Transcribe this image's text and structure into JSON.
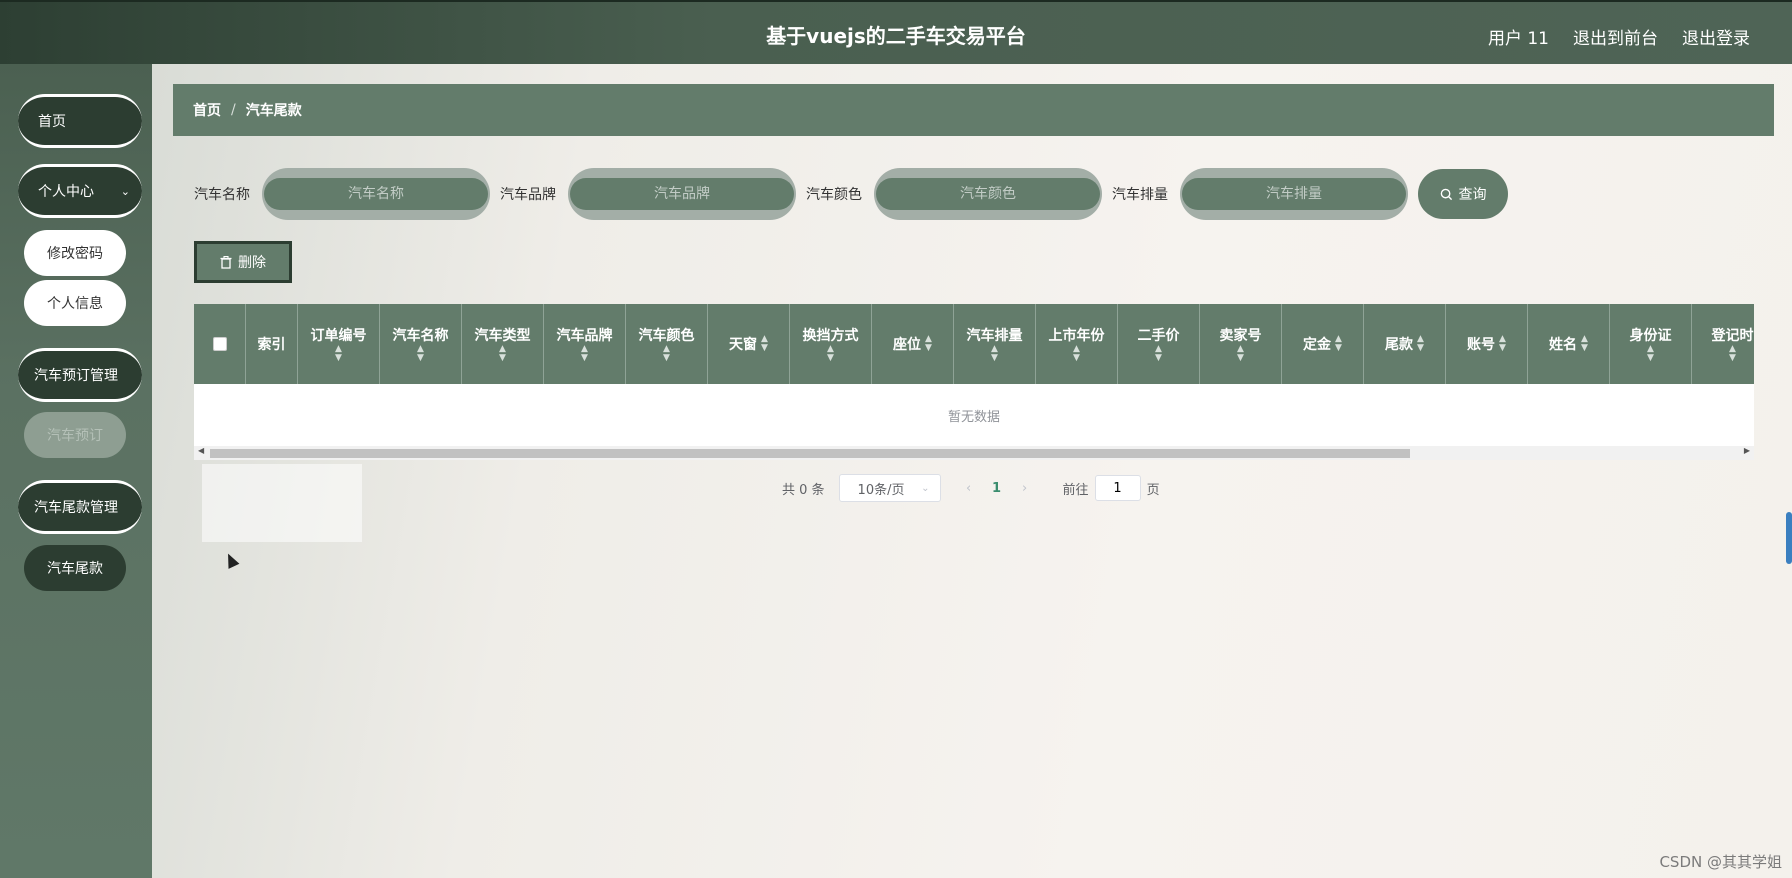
{
  "header": {
    "title": "基于vuejs的二手车交易平台",
    "links": [
      "用户 11",
      "退出到前台",
      "退出登录"
    ]
  },
  "sidebar": {
    "home": "首页",
    "personal": "个人中心",
    "change_password": "修改密码",
    "personal_info": "个人信息",
    "booking_mgmt": "汽车预订管理",
    "booking": "汽车预订",
    "final_mgmt": "汽车尾款管理",
    "final": "汽车尾款"
  },
  "breadcrumb": {
    "home": "首页",
    "separator": "/",
    "current": "汽车尾款"
  },
  "search": {
    "fields": [
      {
        "label": "汽车名称",
        "placeholder": "汽车名称"
      },
      {
        "label": "汽车品牌",
        "placeholder": "汽车品牌"
      },
      {
        "label": "汽车颜色",
        "placeholder": "汽车颜色"
      },
      {
        "label": "汽车排量",
        "placeholder": "汽车排量"
      }
    ],
    "button": "查询"
  },
  "toolbar": {
    "delete": "删除"
  },
  "table": {
    "columns": [
      "索引",
      "订单编号",
      "汽车名称",
      "汽车类型",
      "汽车品牌",
      "汽车颜色",
      "天窗",
      "换挡方式",
      "座位",
      "汽车排量",
      "上市年份",
      "二手价",
      "卖家号",
      "定金",
      "尾款",
      "账号",
      "姓名",
      "身份证",
      "登记时"
    ],
    "empty_text": "暂无数据"
  },
  "pager": {
    "total": "共 0 条",
    "page_size": "10条/页",
    "current_page": "1",
    "goto_label": "前往",
    "goto_value": "1",
    "page_unit": "页"
  },
  "watermark": "CSDN @其其学姐",
  "colors": {
    "accent": "#637c6b",
    "dark": "#2c3d31"
  }
}
